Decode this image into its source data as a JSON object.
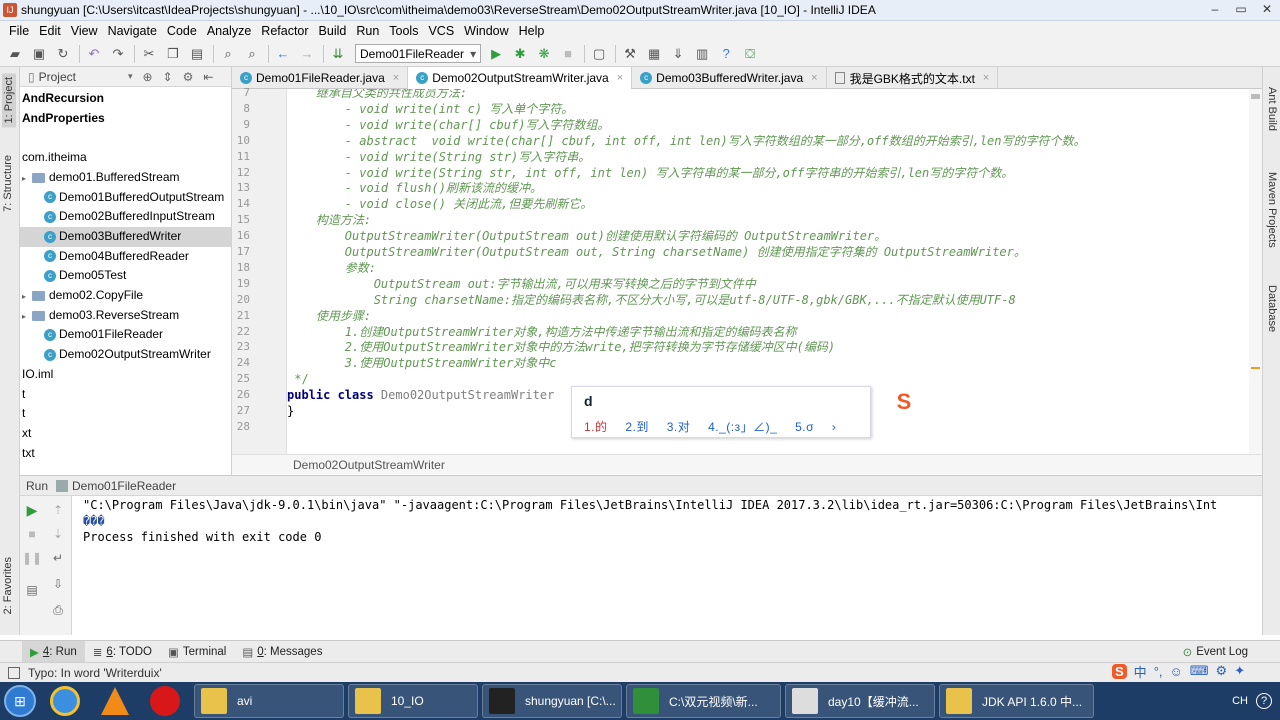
{
  "window": {
    "title": "shungyuan [C:\\Users\\itcast\\IdeaProjects\\shungyuan] - ...\\10_IO\\src\\com\\itheima\\demo03\\ReverseStream\\Demo02OutputStreamWriter.java [10_IO] - IntelliJ IDEA",
    "minimize": "–",
    "maximize": "▭",
    "close": "✕"
  },
  "menu": [
    "File",
    "Edit",
    "View",
    "Navigate",
    "Code",
    "Analyze",
    "Refactor",
    "Build",
    "Run",
    "Tools",
    "VCS",
    "Window",
    "Help"
  ],
  "toolbar": {
    "run_config": "Demo01FileReader",
    "run_config_arrow": "▾"
  },
  "left_strip": {
    "project_tab": "1: Project",
    "structure_tab": "7: Structure",
    "favorites_tab": "2: Favorites"
  },
  "right_strip": {
    "ant_tab": "Ant Build",
    "maven_tab": "Maven Projects",
    "database_tab": "Database"
  },
  "project_panel": {
    "header": "Project",
    "tree": [
      {
        "label": "AndRecursion",
        "bold": true,
        "kind": "text"
      },
      {
        "label": "AndProperties",
        "bold": true,
        "kind": "text"
      },
      {
        "label": "",
        "kind": "blank"
      },
      {
        "label": "com.itheima",
        "kind": "text"
      },
      {
        "label": "demo01.BufferedStream",
        "kind": "folder"
      },
      {
        "label": "Demo01BufferedOutputStream",
        "kind": "class"
      },
      {
        "label": "Demo02BufferedInputStream",
        "kind": "class"
      },
      {
        "label": "Demo03BufferedWriter",
        "kind": "class",
        "selected": true
      },
      {
        "label": "Demo04BufferedReader",
        "kind": "class"
      },
      {
        "label": "Demo05Test",
        "kind": "class"
      },
      {
        "label": "demo02.CopyFile",
        "kind": "folder"
      },
      {
        "label": "demo03.ReverseStream",
        "kind": "folder"
      },
      {
        "label": "Demo01FileReader",
        "kind": "class"
      },
      {
        "label": "Demo02OutputStreamWriter",
        "kind": "class"
      },
      {
        "label": "IO.iml",
        "kind": "text"
      },
      {
        "label": "t",
        "kind": "text"
      },
      {
        "label": "t",
        "kind": "text"
      },
      {
        "label": "xt",
        "kind": "text"
      },
      {
        "label": "txt",
        "kind": "text"
      }
    ]
  },
  "tabs": [
    {
      "label": "Demo01FileReader.java",
      "active": false
    },
    {
      "label": "Demo02OutputStreamWriter.java",
      "active": true
    },
    {
      "label": "Demo03BufferedWriter.java",
      "active": false
    },
    {
      "label": "我是GBK格式的文本.txt",
      "active": false
    }
  ],
  "editor": {
    "lines": [
      {
        "n": "7",
        "text": "    继承自父类的共性成员方法:"
      },
      {
        "n": "8",
        "text": "        - void write(int c) 写入单个字符。"
      },
      {
        "n": "9",
        "text": "        - void write(char[] cbuf)写入字符数组。"
      },
      {
        "n": "10",
        "text": "        - abstract  void write(char[] cbuf, int off, int len)写入字符数组的某一部分,off数组的开始索引,len写的字符个数。"
      },
      {
        "n": "11",
        "text": "        - void write(String str)写入字符串。"
      },
      {
        "n": "12",
        "text": "        - void write(String str, int off, int len) 写入字符串的某一部分,off字符串的开始索引,len写的字符个数。"
      },
      {
        "n": "13",
        "text": "        - void flush()刷新该流的缓冲。"
      },
      {
        "n": "14",
        "text": "        - void close() 关闭此流,但要先刷新它。"
      },
      {
        "n": "15",
        "text": "    构造方法:"
      },
      {
        "n": "16",
        "text": "        OutputStreamWriter(OutputStream out)创建使用默认字符编码的 OutputStreamWriter。"
      },
      {
        "n": "17",
        "text": "        OutputStreamWriter(OutputStream out, String charsetName) 创建使用指定字符集的 OutputStreamWriter。"
      },
      {
        "n": "18",
        "text": "        参数:"
      },
      {
        "n": "19",
        "text": "            OutputStream out:字节输出流,可以用来写转换之后的字节到文件中"
      },
      {
        "n": "20",
        "text": "            String charsetName:指定的编码表名称,不区分大小写,可以是utf-8/UTF-8,gbk/GBK,...不指定默认使用UTF-8"
      },
      {
        "n": "21",
        "text": "    使用步骤:"
      },
      {
        "n": "22",
        "text": "        1.创建OutputStreamWriter对象,构造方法中传递字节输出流和指定的编码表名称"
      },
      {
        "n": "23",
        "text": "        2.使用OutputStreamWriter对象中的方法write,把字符转换为字节存储缓冲区中(编码)"
      },
      {
        "n": "24",
        "text": "        3.使用OutputStreamWriter对象中c"
      },
      {
        "n": "25",
        "text": " */"
      },
      {
        "n": "26",
        "text": "public class Demo02OutputStreamWriter {"
      },
      {
        "n": "27",
        "text": "}"
      },
      {
        "n": "28",
        "text": ""
      }
    ],
    "line26_keyword": "public class ",
    "line26_name": "Demo02OutputStreamWriter",
    "breadcrumb": "Demo02OutputStreamWriter"
  },
  "ime_popup": {
    "input": "d",
    "candidates": [
      "1.的",
      "2.到",
      "3.对",
      "4._(:з」∠)_",
      "5.σ",
      "›"
    ]
  },
  "run_panel": {
    "header_label": "Run",
    "config": "Demo01FileReader",
    "console": [
      "\"C:\\Program Files\\Java\\jdk-9.0.1\\bin\\java\" \"-javaagent:C:\\Program Files\\JetBrains\\IntelliJ IDEA 2017.3.2\\lib\\idea_rt.jar=50306:C:\\Program Files\\JetBrains\\Int",
      "���",
      "",
      "Process finished with exit code 0"
    ]
  },
  "bottom_tabs": [
    {
      "num": "4",
      "label": ": Run",
      "active": true
    },
    {
      "num": "6",
      "label": ": TODO",
      "active": false
    },
    {
      "num": "",
      "label": "Terminal",
      "active": false
    },
    {
      "num": "0",
      "label": ": Messages",
      "active": false
    }
  ],
  "event_log": "Event Log",
  "status": "Typo: In word 'Writerduix'",
  "ime_bar": [
    "S",
    "中",
    "°,",
    "☺",
    "⌨",
    "⚙",
    "✦"
  ],
  "taskbar": {
    "start": "⊞",
    "items": [
      {
        "label": "avi",
        "color": "#e8c24a"
      },
      {
        "label": "10_IO",
        "color": "#e8c24a"
      },
      {
        "label": "shungyuan [C:\\...",
        "color": "#222222"
      },
      {
        "label": "C:\\双元视频\\新...",
        "color": "#2f8f3a"
      },
      {
        "label": "day10【缓冲流...",
        "color": "#dddddd"
      },
      {
        "label": "JDK API 1.6.0 中...",
        "color": "#e8c24a"
      }
    ],
    "tray": [
      "CH",
      "?"
    ]
  }
}
